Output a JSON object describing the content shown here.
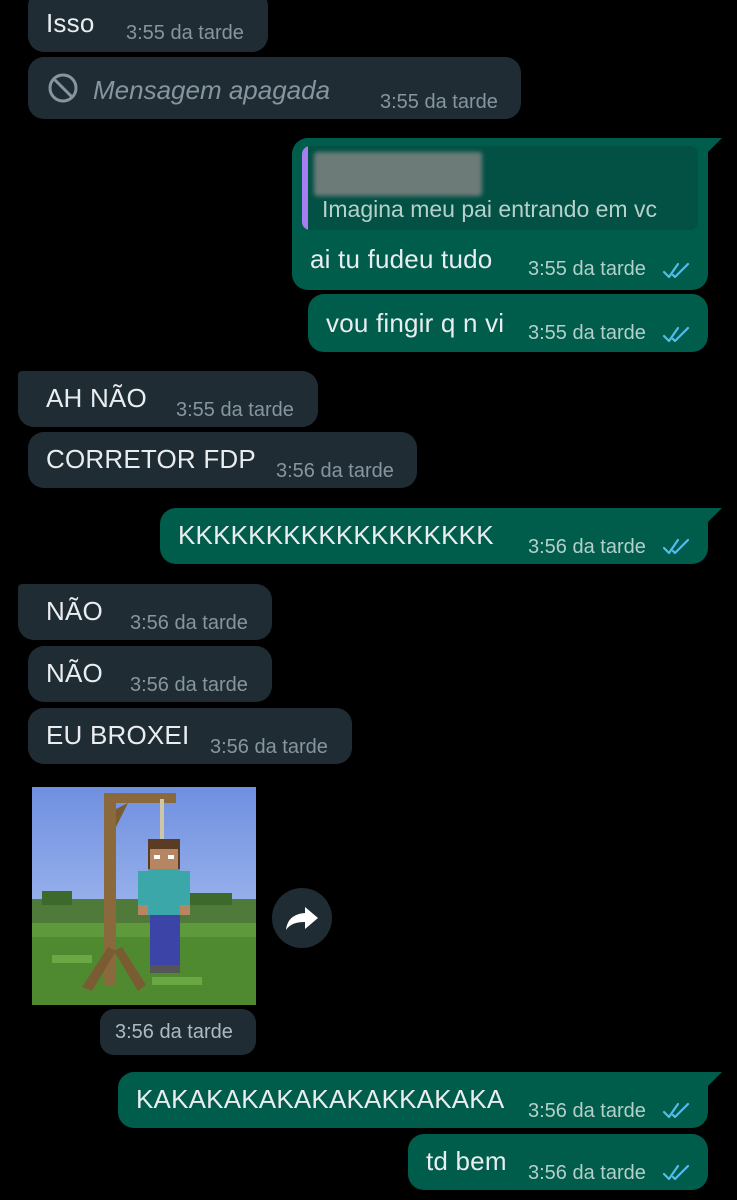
{
  "chat": {
    "messages": [
      {
        "text": "Isso",
        "time": "3:55 da tarde"
      },
      {
        "text": "Mensagem apagada",
        "time": "3:55 da tarde"
      },
      {
        "quoted_text": "Imagina meu pai entrando em vc",
        "text": "ai tu fudeu tudo",
        "time": "3:55 da tarde"
      },
      {
        "text": "vou fingir q n vi",
        "time": "3:55 da tarde"
      },
      {
        "text": "AH NÃO",
        "time": "3:55 da tarde"
      },
      {
        "text": "CORRETOR FDP",
        "time": "3:56 da tarde"
      },
      {
        "text": "KKKKKKKKKKKKKKKKKK",
        "time": "3:56 da tarde"
      },
      {
        "text": "NÃO",
        "time": "3:56 da tarde"
      },
      {
        "text": "NÃO",
        "time": "3:56 da tarde"
      },
      {
        "text": "EU BROXEI",
        "time": "3:56 da tarde"
      },
      {
        "image": "minecraft-steve-gallows",
        "time": "3:56 da tarde"
      },
      {
        "text": "KAKAKAKAKAKAKAKKAKAKA",
        "time": "3:56 da tarde"
      },
      {
        "text": "td bem",
        "time": "3:56 da tarde"
      }
    ]
  },
  "colors": {
    "background": "#000000",
    "incoming_bubble": "#1f2c34",
    "outgoing_bubble": "#005c4b",
    "read_ticks": "#53bdeb",
    "meta_text": "#8696a0"
  },
  "icons": {
    "deleted": "prohibited-icon",
    "ticks": "double-check-icon",
    "forward": "forward-arrow-icon"
  }
}
